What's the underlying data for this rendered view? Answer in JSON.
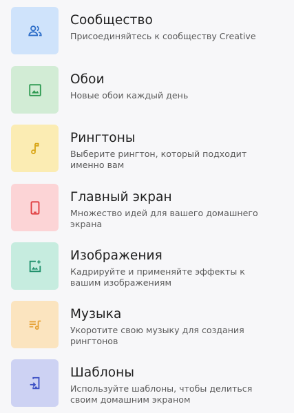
{
  "menu": {
    "items": [
      {
        "title": "Сообщество",
        "description": "Присоединяйтесь к сообществу Creative",
        "icon": "people-icon",
        "tile_color": "#cfe3fb",
        "icon_color": "#2f6fc9"
      },
      {
        "title": "Обои",
        "description": "Новые обои каждый день",
        "icon": "image-icon",
        "tile_color": "#d2ecd5",
        "icon_color": "#2f9a52"
      },
      {
        "title": "Рингтоны",
        "description": "Выберите рингтон, который подходит именно вам",
        "icon": "music-note-icon",
        "tile_color": "#fbecb3",
        "icon_color": "#d8a516"
      },
      {
        "title": "Главный экран",
        "description": "Множество идей для вашего домашнего экрана",
        "icon": "phone-icon",
        "tile_color": "#fcd4d6",
        "icon_color": "#df3a3d"
      },
      {
        "title": "Изображения",
        "description": "Кадрируйте и применяйте эффекты к вашим изображениям",
        "icon": "image-effects-icon",
        "tile_color": "#c6ecdf",
        "icon_color": "#1e8f6a"
      },
      {
        "title": "Музыка",
        "description": "Укоротите свою музыку для создания рингтонов",
        "icon": "music-list-icon",
        "tile_color": "#fbe4bf",
        "icon_color": "#e6a238"
      },
      {
        "title": "Шаблоны",
        "description": "Используйте шаблоны, чтобы делиться своим домашним экраном",
        "icon": "template-icon",
        "tile_color": "#cdd2f3",
        "icon_color": "#3c4fc4"
      }
    ]
  }
}
